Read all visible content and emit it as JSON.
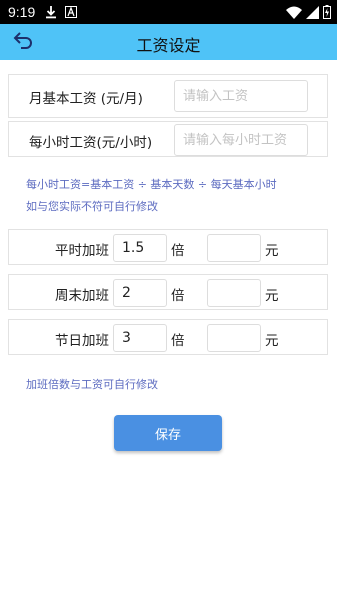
{
  "status_bar": {
    "time": "9:19",
    "icons": [
      "download-icon",
      "a-icon",
      "wifi-icon",
      "signal-icon",
      "battery-icon"
    ]
  },
  "header": {
    "title": "工资设定",
    "back_icon": "back-arrow-icon",
    "color": "#4fc3f7"
  },
  "salary": {
    "monthly": {
      "label": "月基本工资  (元/月)",
      "placeholder": "请输入工资",
      "value": ""
    },
    "hourly": {
      "label": "每小时工资(元/小时)",
      "placeholder": "请输入每小时工资",
      "value": ""
    },
    "hint_formula": "每小时工资=基本工资 ÷ 基本天数 ÷ 每天基本小时",
    "hint_modify": "如与您实际不符可自行修改"
  },
  "overtime": {
    "multiplier_unit": "倍",
    "amount_unit": "元",
    "rows": [
      {
        "label": "平时加班",
        "multiplier": "1.5",
        "amount": ""
      },
      {
        "label": "周末加班",
        "multiplier": "2",
        "amount": ""
      },
      {
        "label": "节日加班",
        "multiplier": "3",
        "amount": ""
      }
    ],
    "hint": "加班倍数与工资可自行修改"
  },
  "save_button": {
    "label": "保存",
    "color": "#4a90e2"
  }
}
